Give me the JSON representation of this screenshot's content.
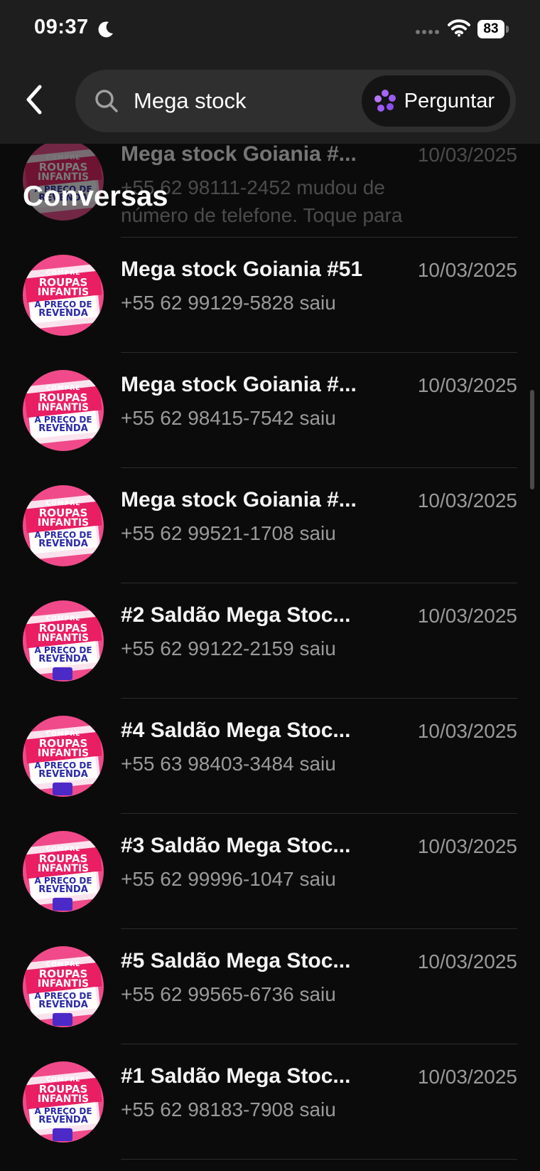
{
  "status_bar": {
    "time": "09:37",
    "battery": "83",
    "icons": [
      "moon-icon",
      "signal-icon",
      "wifi-icon",
      "battery-icon"
    ]
  },
  "search": {
    "query": "Mega stock",
    "ask_label": "Perguntar",
    "icons": [
      "back-arrow-icon",
      "search-icon",
      "sparkle-icon"
    ]
  },
  "section_heading": "Conversas",
  "colors": {
    "background": "#0b0b0b",
    "header": "#1e1e1e",
    "search_box": "#2f2f2f",
    "ask_icon": "#9b5cf6",
    "avatar_pink": "#f04a8a"
  },
  "conversations": [
    {
      "title": "Mega stock Goiania #...",
      "subtitle": "+55 62 98111-2452 mudou de número de telefone. Toque para e...",
      "date": "10/03/2025",
      "avatar_variant": "a"
    },
    {
      "title": "Mega stock Goiania #51",
      "subtitle": "+55 62 99129-5828 saiu",
      "date": "10/03/2025",
      "avatar_variant": "a"
    },
    {
      "title": "Mega stock Goiania #...",
      "subtitle": "+55 62 98415-7542 saiu",
      "date": "10/03/2025",
      "avatar_variant": "a"
    },
    {
      "title": "Mega stock Goiania #...",
      "subtitle": "+55 62 99521-1708 saiu",
      "date": "10/03/2025",
      "avatar_variant": "a"
    },
    {
      "title": "#2 Saldão Mega Stoc...",
      "subtitle": "+55 62 99122-2159 saiu",
      "date": "10/03/2025",
      "avatar_variant": "b"
    },
    {
      "title": "#4 Saldão Mega Stoc...",
      "subtitle": "+55 63 98403-3484 saiu",
      "date": "10/03/2025",
      "avatar_variant": "b"
    },
    {
      "title": "#3 Saldão Mega Stoc...",
      "subtitle": "+55 62 99996-1047 saiu",
      "date": "10/03/2025",
      "avatar_variant": "b"
    },
    {
      "title": "#5 Saldão Mega Stoc...",
      "subtitle": "+55 62 99565-6736 saiu",
      "date": "10/03/2025",
      "avatar_variant": "b"
    },
    {
      "title": "#1 Saldão Mega Stoc...",
      "subtitle": "+55 62 98183-7908 saiu",
      "date": "10/03/2025",
      "avatar_variant": "b"
    }
  ],
  "avatar_text": {
    "line1": "COMPRE",
    "line2": "ROUPAS",
    "line3": "INFANTIS",
    "line4": "A PREÇO DE",
    "line5": "REVENDA"
  }
}
